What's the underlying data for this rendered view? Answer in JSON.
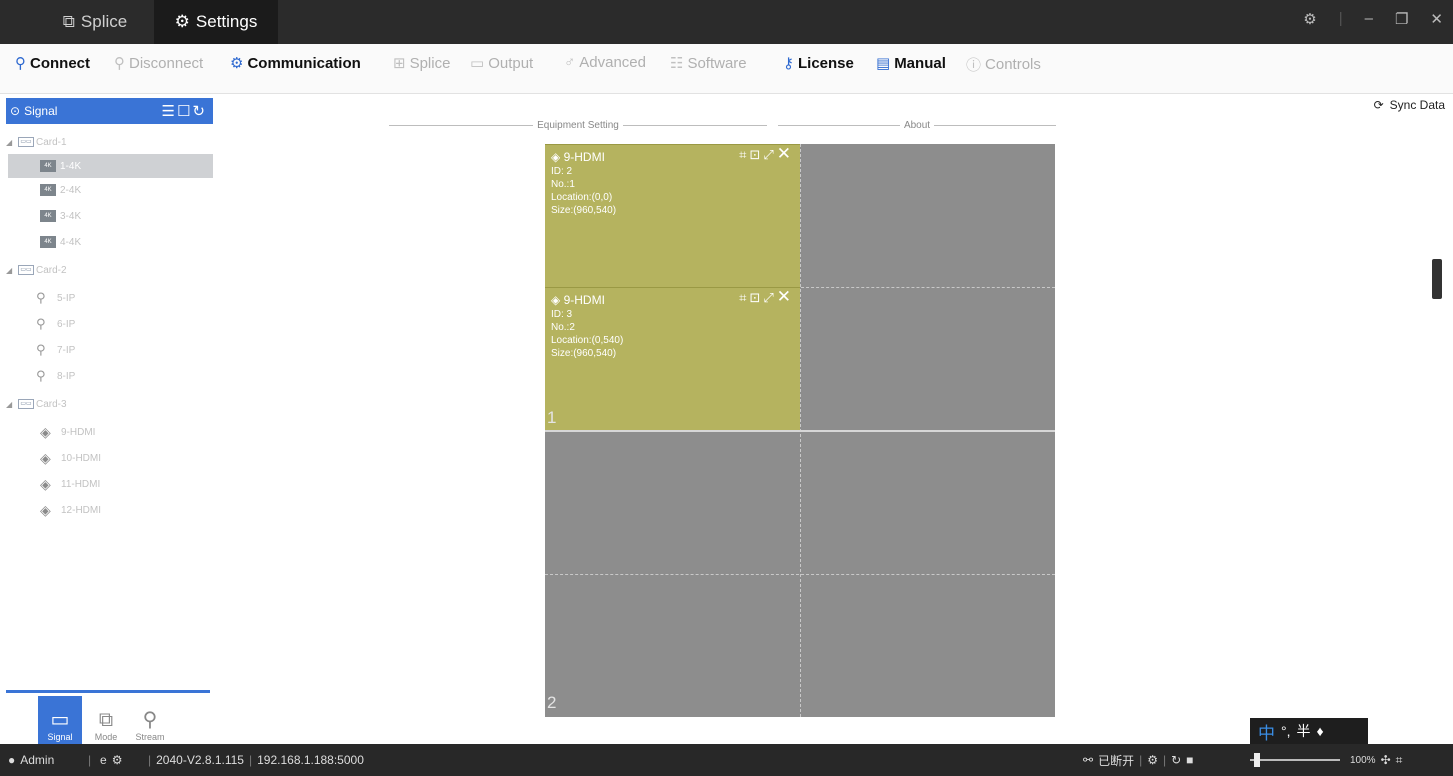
{
  "titlebar": {
    "tabs": [
      {
        "label": "Splice",
        "icon": "window-icon",
        "active": false
      },
      {
        "label": "Settings",
        "icon": "gear-icon",
        "active": true
      }
    ],
    "controls": [
      "settings-icon",
      "minimize-icon",
      "restore-icon",
      "close-icon"
    ]
  },
  "toolbar": {
    "items": [
      {
        "label": "Connect",
        "enabled": true,
        "icon": "connect-icon"
      },
      {
        "label": "Disconnect",
        "enabled": false,
        "icon": "disconnect-icon"
      },
      {
        "label": "Communication",
        "enabled": true,
        "icon": "gear-icon"
      },
      {
        "label": "Splice",
        "enabled": false,
        "icon": "grid-icon"
      },
      {
        "label": "Output",
        "enabled": false,
        "icon": "output-icon"
      },
      {
        "label": "Advanced",
        "enabled": false,
        "icon": "advanced-icon"
      },
      {
        "label": "Software",
        "enabled": false,
        "icon": "sliders-icon"
      },
      {
        "label": "License",
        "enabled": true,
        "icon": "key-icon"
      },
      {
        "label": "Manual",
        "enabled": true,
        "icon": "document-icon"
      },
      {
        "label": "Controls",
        "enabled": false,
        "icon": "info-icon"
      }
    ],
    "groups": {
      "equipment": "Equipment Setting",
      "about": "About"
    }
  },
  "sidebar": {
    "header": "Signal",
    "tree": [
      {
        "card": "Card-1",
        "items": [
          "1-4K",
          "2-4K",
          "3-4K",
          "4-4K"
        ],
        "selected": "1-4K"
      },
      {
        "card": "Card-2",
        "items": [
          "5-IP",
          "6-IP",
          "7-IP",
          "8-IP"
        ]
      },
      {
        "card": "Card-3",
        "items": [
          "9-HDMI",
          "10-HDMI",
          "11-HDMI",
          "12-HDMI"
        ]
      }
    ],
    "modes": [
      {
        "label": "Signal",
        "icon": "monitor-icon",
        "active": true
      },
      {
        "label": "Mode",
        "icon": "copy-icon",
        "active": false
      },
      {
        "label": "Stream",
        "icon": "camera-icon",
        "active": false
      }
    ]
  },
  "sync": {
    "label": "Sync Data"
  },
  "canvas": {
    "screens": [
      "1",
      "2"
    ],
    "windows": [
      {
        "title": "9-HDMI",
        "id": "ID: 2",
        "no": "No.:1",
        "location": "Location:(0,0)",
        "size": "Size:(960,540)"
      },
      {
        "title": "9-HDMI",
        "id": "ID: 3",
        "no": "No.:2",
        "location": "Location:(0,540)",
        "size": "Size:(960,540)"
      }
    ],
    "accent": "#b5b35f"
  },
  "ime": {
    "lang": "中",
    "punct": "°,",
    "width": "半"
  },
  "status": {
    "user": "Admin",
    "version": "2040-V2.8.1.115",
    "address": "192.168.1.188:5000",
    "connection": "已断开",
    "zoom": "100%"
  },
  "colors": {
    "accent": "#3a74d6",
    "titlebar": "#2b2b2b",
    "statusbar": "#282828"
  }
}
